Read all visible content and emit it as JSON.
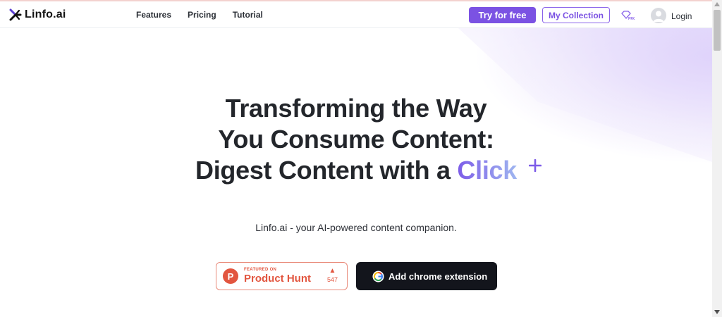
{
  "nav": {
    "brand": "Linfo.ai",
    "links": [
      "Features",
      "Pricing",
      "Tutorial"
    ],
    "try_label": "Try for free",
    "collection_label": "My Collection",
    "pro_icon": "pro-badge-icon",
    "login_label": "Login"
  },
  "hero": {
    "line1": "Transforming the Way",
    "line2": "You Consume Content:",
    "line3_prefix": "Digest Content with a ",
    "line3_accent": "Click",
    "subtitle": "Linfo.ai - your AI-powered content companion."
  },
  "product_hunt": {
    "featured": "FEATURED ON",
    "name": "Product Hunt",
    "votes": "547",
    "logo_letter": "P"
  },
  "chrome": {
    "label": "Add chrome extension"
  },
  "colors": {
    "accent": "#7b52e3",
    "product_hunt": "#e2553f",
    "dark_button": "#13151c"
  }
}
